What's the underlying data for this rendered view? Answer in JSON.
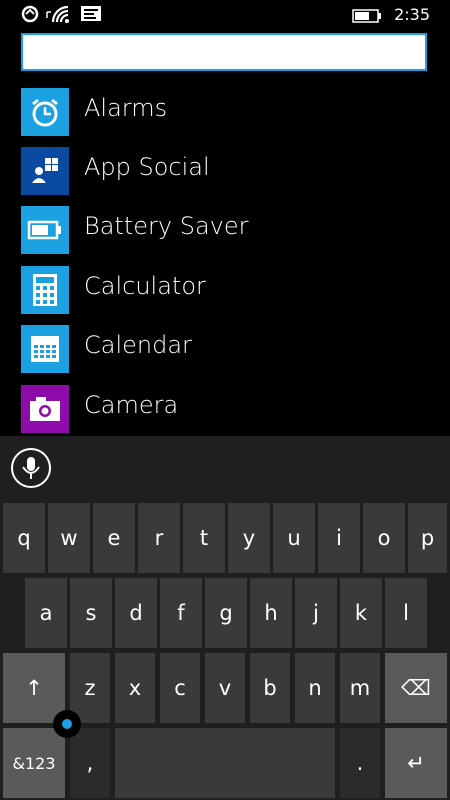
{
  "status_bar": {
    "time": "2:35",
    "icons": [
      "sync-icon",
      "signal-icon",
      "wifi-icon",
      "message-icon",
      "battery-icon"
    ]
  },
  "search": {
    "value": "",
    "placeholder": ""
  },
  "apps": [
    {
      "label": "Alarms",
      "icon": "alarm-icon",
      "color": "#1ba1e2"
    },
    {
      "label": "App Social",
      "icon": "app-social-icon",
      "color": "#0a4aa0"
    },
    {
      "label": "Battery Saver",
      "icon": "battery-saver-icon",
      "color": "#1ba1e2"
    },
    {
      "label": "Calculator",
      "icon": "calculator-icon",
      "color": "#1ba1e2"
    },
    {
      "label": "Calendar",
      "icon": "calendar-icon",
      "color": "#1ba1e2"
    },
    {
      "label": "Camera",
      "icon": "camera-icon",
      "color": "#8e0caa"
    }
  ],
  "keyboard": {
    "row1": [
      "q",
      "w",
      "e",
      "r",
      "t",
      "y",
      "u",
      "i",
      "o",
      "p"
    ],
    "row2": [
      "a",
      "s",
      "d",
      "f",
      "g",
      "h",
      "j",
      "k",
      "l"
    ],
    "row3": [
      "z",
      "x",
      "c",
      "v",
      "b",
      "n",
      "m"
    ],
    "shift": "↑",
    "backspace": "⌫",
    "symbols": "&123",
    "comma": ",",
    "period": ".",
    "space": "",
    "enter": "↵"
  },
  "colors": {
    "accent": "#1ba1e2",
    "key": "#3a3a3a",
    "key_function": "#5a5a5a",
    "keyboard_bg": "#1f1f1f"
  }
}
